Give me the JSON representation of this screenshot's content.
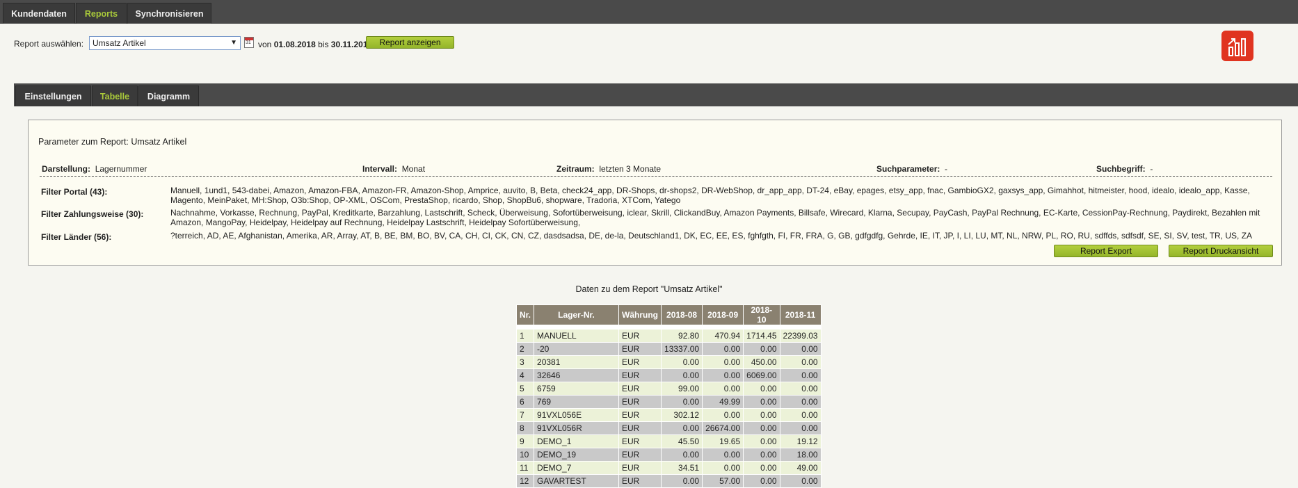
{
  "topnav": {
    "tabs": [
      {
        "label": "Kundendaten",
        "active": false
      },
      {
        "label": "Reports",
        "active": true
      },
      {
        "label": "Synchronisieren",
        "active": false
      }
    ]
  },
  "report_select": {
    "label": "Report auswählen:",
    "value": "Umsatz Artikel",
    "von": "von",
    "date_from": "01.08.2018",
    "bis": "bis",
    "date_to": "30.11.2018",
    "show_button": "Report anzeigen"
  },
  "subnav": {
    "tabs": [
      {
        "label": "Einstellungen",
        "active": false
      },
      {
        "label": "Tabelle",
        "active": true
      },
      {
        "label": "Diagramm",
        "active": false
      }
    ]
  },
  "params": {
    "title": "Parameter zum Report: Umsatz Artikel",
    "darstellung_label": "Darstellung:",
    "darstellung_value": "Lagernummer",
    "intervall_label": "Intervall:",
    "intervall_value": "Monat",
    "zeitraum_label": "Zeitraum:",
    "zeitraum_value": "letzten 3 Monate",
    "suchparameter_label": "Suchparameter:",
    "suchparameter_value": "-",
    "suchbegriff_label": "Suchbegriff:",
    "suchbegriff_value": "-",
    "filter_portal_label": "Filter Portal (43):",
    "filter_portal_value": "Manuell, 1und1, 543-dabei, Amazon, Amazon-FBA, Amazon-FR, Amazon-Shop, Amprice, auvito, B, Beta, check24_app, DR-Shops, dr-shops2, DR-WebShop, dr_app_app, DT-24, eBay, epages, etsy_app, fnac, GambioGX2, gaxsys_app, Gimahhot, hitmeister, hood, idealo, idealo_app, Kasse, Magento, MeinPaket, MH:Shop, O3b:Shop, OP-XML, OSCom, PrestaShop, ricardo, Shop, ShopBu6, shopware, Tradoria, XTCom, Yatego",
    "filter_zahlung_label": "Filter Zahlungsweise (30):",
    "filter_zahlung_value": "Nachnahme, Vorkasse, Rechnung, PayPal, Kreditkarte, Barzahlung, Lastschrift, Scheck, Überweisung, Sofortüberweisung, iclear, Skrill, ClickandBuy, Amazon Payments, Billsafe, Wirecard, Klarna, Secupay, PayCash, PayPal Rechnung, EC-Karte, CessionPay-Rechnung, Paydirekt, Bezahlen mit Amazon, MangoPay, Heidelpay, Heidelpay auf Rechnung, Heidelpay Lastschrift, Heidelpay Sofortüberweisung,",
    "filter_laender_label": "Filter Länder (56):",
    "filter_laender_value": "?terreich, AD, AE, Afghanistan, Amerika, AR, Array, AT, B, BE, BM, BO, BV, CA, CH, CI, CK, CN, CZ, dasdsadsa, DE, de-la, Deutschland1, DK, EC, EE, ES, fghfgth, FI, FR, FRA, G, GB, gdfgdfg, Gehrde, IE, IT, JP, I, LI, LU, MT, NL, NRW, PL, RO, RU, sdffds, sdfsdf, SE, SI, SV, test, TR, US, ZA",
    "export_button": "Report Export",
    "print_button": "Report Druckansicht"
  },
  "table": {
    "title": "Daten zu dem Report \"Umsatz Artikel\"",
    "headers": [
      "Nr.",
      "Lager-Nr.",
      "Währung",
      "2018-08",
      "2018-09",
      "2018-10",
      "2018-11"
    ],
    "rows": [
      [
        "1",
        "MANUELL",
        "EUR",
        "92.80",
        "470.94",
        "1714.45",
        "22399.03"
      ],
      [
        "2",
        "-20",
        "EUR",
        "13337.00",
        "0.00",
        "0.00",
        "0.00"
      ],
      [
        "3",
        "20381",
        "EUR",
        "0.00",
        "0.00",
        "450.00",
        "0.00"
      ],
      [
        "4",
        "32646",
        "EUR",
        "0.00",
        "0.00",
        "6069.00",
        "0.00"
      ],
      [
        "5",
        "6759",
        "EUR",
        "99.00",
        "0.00",
        "0.00",
        "0.00"
      ],
      [
        "6",
        "769",
        "EUR",
        "0.00",
        "49.99",
        "0.00",
        "0.00"
      ],
      [
        "7",
        "91VXL056E",
        "EUR",
        "302.12",
        "0.00",
        "0.00",
        "0.00"
      ],
      [
        "8",
        "91VXL056R",
        "EUR",
        "0.00",
        "26674.00",
        "0.00",
        "0.00"
      ],
      [
        "9",
        "DEMO_1",
        "EUR",
        "45.50",
        "19.65",
        "0.00",
        "19.12"
      ],
      [
        "10",
        "DEMO_19",
        "EUR",
        "0.00",
        "0.00",
        "0.00",
        "18.00"
      ],
      [
        "11",
        "DEMO_7",
        "EUR",
        "34.51",
        "0.00",
        "0.00",
        "49.00"
      ],
      [
        "12",
        "GAVARTEST",
        "EUR",
        "0.00",
        "57.00",
        "0.00",
        "0.00"
      ]
    ]
  },
  "colors": {
    "accent_green": "#a9c93a",
    "nav_bg": "#4a4a4a",
    "logo_red": "#e03420",
    "table_header": "#8a8170"
  },
  "icons": {
    "calendar": "calendar-icon",
    "logo": "bar-chart-logo-icon"
  }
}
